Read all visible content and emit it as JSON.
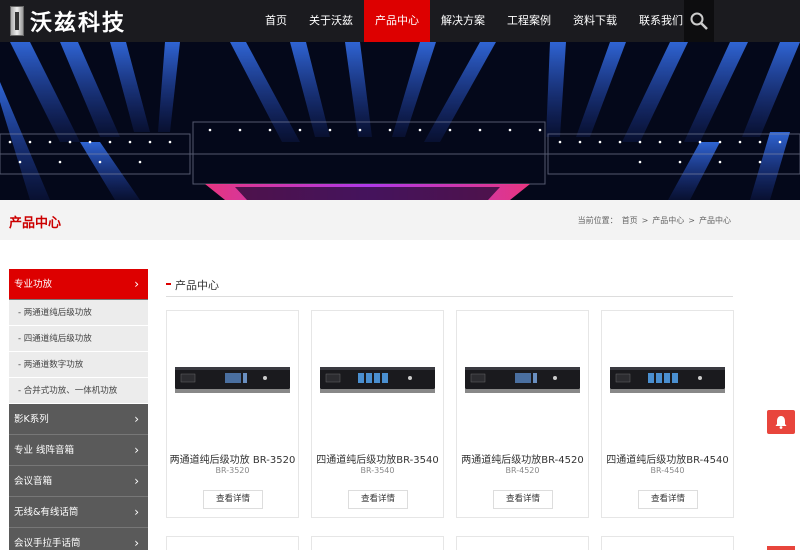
{
  "header": {
    "logo_text": "沃兹科技",
    "nav": [
      "首页",
      "关于沃兹",
      "产品中心",
      "解决方案",
      "工程案例",
      "资料下载",
      "联系我们"
    ],
    "active_nav": "产品中心",
    "search_icon": "search-icon"
  },
  "titlebar": {
    "title": "产品中心",
    "crumb_prefix": "当前位置：",
    "crumb_home": "首页",
    "crumb_sep": ">",
    "crumb_1": "产品中心",
    "crumb_2": "产品中心"
  },
  "sidebar": {
    "active_category": "专业功放",
    "sub_items": [
      "- 两通道纯后级功放",
      "- 四通道纯后级功放",
      "- 两通道数字功放",
      "- 合并式功放、一体机功放"
    ],
    "categories": [
      "影K系列",
      "专业 线阵音箱",
      "会议音箱",
      "无线&有线话筒",
      "会议手拉手话筒"
    ],
    "arrow": "›"
  },
  "main": {
    "heading": "产品中心",
    "detail_label": "查看详情",
    "products": [
      {
        "name": "两通道纯后级功放 BR-3520",
        "model": "BR-3520"
      },
      {
        "name": "四通道纯后级功放BR-3540",
        "model": "BR-3540"
      },
      {
        "name": "两通道纯后级功放BR-4520",
        "model": "BR-4520"
      },
      {
        "name": "四通道纯后级功放BR-4540",
        "model": "BR-4540"
      }
    ]
  },
  "colors": {
    "accent": "#dd0000",
    "header_bg": "#1b1b1f",
    "sidebar_bg": "#5a5a5a"
  }
}
